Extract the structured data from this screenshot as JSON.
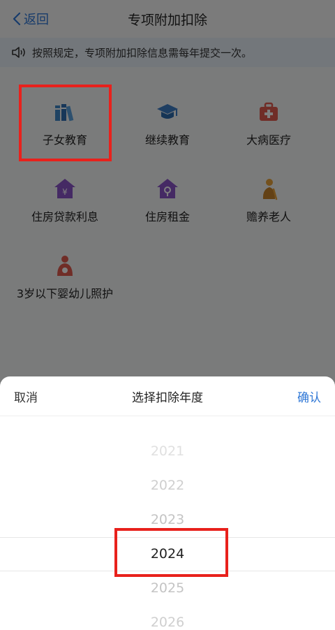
{
  "nav": {
    "back_label": "返回",
    "title": "专项附加扣除"
  },
  "notice": {
    "text": "按照规定，专项附加扣除信息需每年提交一次。"
  },
  "categories": [
    {
      "label": "子女教育",
      "icon": "books-icon",
      "color": "#3f86c6"
    },
    {
      "label": "继续教育",
      "icon": "graduation-cap-icon",
      "color": "#3c7dc4"
    },
    {
      "label": "大病医疗",
      "icon": "medical-kit-icon",
      "color": "#e15b4f"
    },
    {
      "label": "住房贷款利息",
      "icon": "house-yuan-icon",
      "color": "#8a55c9"
    },
    {
      "label": "住房租金",
      "icon": "house-key-icon",
      "color": "#8a55c9"
    },
    {
      "label": "赡养老人",
      "icon": "elder-person-icon",
      "color": "#e8a33a"
    },
    {
      "label": "3岁以下婴幼儿照护",
      "icon": "mother-baby-icon",
      "color": "#e15b4f"
    }
  ],
  "sheet": {
    "cancel_label": "取消",
    "title": "选择扣除年度",
    "confirm_label": "确认",
    "years": [
      "2021",
      "2022",
      "2023",
      "2024",
      "2025",
      "2026"
    ],
    "selected_year": "2024"
  },
  "colors": {
    "accent": "#2f77d6",
    "highlight": "#e8211c"
  }
}
